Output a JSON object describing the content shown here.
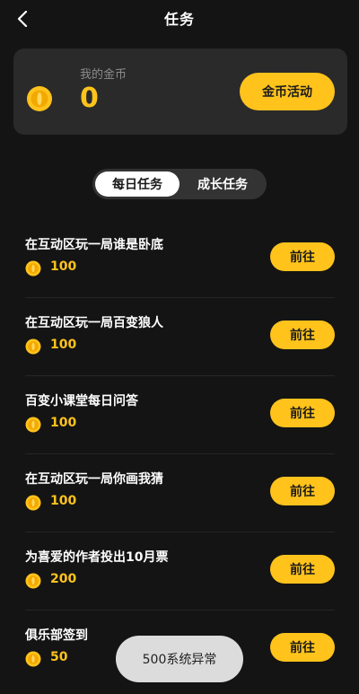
{
  "header": {
    "title": "任务"
  },
  "wallet": {
    "label": "我的金币",
    "value": "0",
    "activity_button": "金币活动"
  },
  "tabs": [
    {
      "label": "每日任务",
      "active": true
    },
    {
      "label": "成长任务",
      "active": false
    }
  ],
  "tasks": [
    {
      "title": "在互动区玩一局谁是卧底",
      "reward": "100",
      "action": "前往"
    },
    {
      "title": "在互动区玩一局百变狼人",
      "reward": "100",
      "action": "前往"
    },
    {
      "title": "百变小课堂每日问答",
      "reward": "100",
      "action": "前往"
    },
    {
      "title": "在互动区玩一局你画我猜",
      "reward": "100",
      "action": "前往"
    },
    {
      "title": "为喜爱的作者投出10月票",
      "reward": "200",
      "action": "前往"
    },
    {
      "title": "俱乐部签到",
      "reward": "50",
      "action": "前往"
    }
  ],
  "toast": {
    "message": "500系统异常"
  },
  "icons": {
    "back": "chevron-left-icon",
    "coin": "gold-coin-icon"
  },
  "colors": {
    "background": "#141414",
    "card": "#2a2a2a",
    "accent": "#ffc31c",
    "muted_text": "#8c8c8c",
    "toast_bg": "#dcdcdc"
  }
}
